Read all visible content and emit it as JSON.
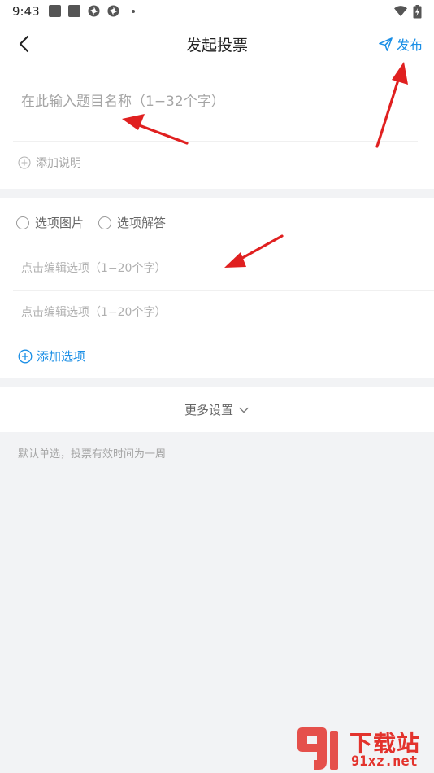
{
  "status_bar": {
    "time": "9:43",
    "icons": [
      "gallery-icon",
      "gallery-icon",
      "pinwheel-icon",
      "pinwheel-icon",
      "dot-icon",
      "wifi-icon",
      "battery-icon"
    ]
  },
  "header": {
    "title": "发起投票",
    "back_icon": "chevron-left-icon",
    "publish_label": "发布",
    "publish_icon": "paper-plane-icon"
  },
  "title_section": {
    "title_placeholder": "在此输入题目名称（1−32个字）",
    "add_desc_label": "添加说明"
  },
  "options_section": {
    "radio_image_label": "选项图片",
    "radio_answer_label": "选项解答",
    "options": [
      {
        "placeholder": "点击编辑选项（1−20个字）"
      },
      {
        "placeholder": "点击编辑选项（1−20个字）"
      }
    ],
    "add_option_label": "添加选项"
  },
  "more": {
    "label": "更多设置"
  },
  "hint": "默认单选，投票有效时间为一周",
  "watermark": {
    "title": "下载站",
    "url": "91xz.net"
  },
  "colors": {
    "accent": "#1b8fe6",
    "background": "#f2f3f5",
    "arrow": "#e02020",
    "watermark": "#e3332d"
  }
}
